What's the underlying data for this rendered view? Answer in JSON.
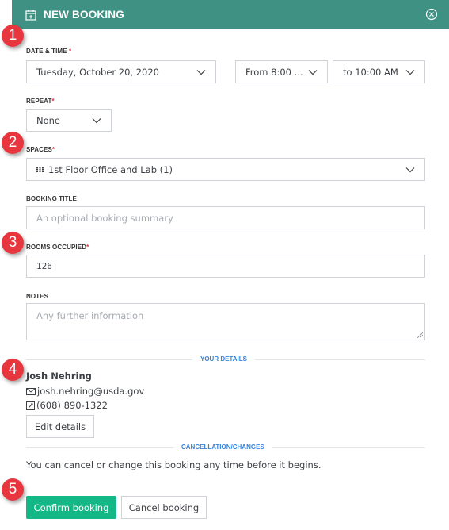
{
  "header": {
    "title": "NEW BOOKING",
    "icon": "calendar-plus-icon",
    "close_icon": "close-circle-icon"
  },
  "date_time": {
    "label": "DATE & TIME",
    "required": "*",
    "date_value": "Tuesday, October 20, 2020",
    "from_value": "From 8:00 ...",
    "to_value": "to 10:00 AM"
  },
  "repeat": {
    "label": "REPEAT",
    "required": "*",
    "value": "None"
  },
  "spaces": {
    "label": "SPACES",
    "required": "*",
    "value": "1st Floor Office and Lab (1)",
    "icon": "grid-icon"
  },
  "booking_title": {
    "label": "BOOKING TITLE",
    "placeholder": "An optional booking summary",
    "value": ""
  },
  "rooms_occupied": {
    "label": "ROOMS OCCUPIED",
    "required": "*",
    "value": "126"
  },
  "notes": {
    "label": "NOTES",
    "placeholder": "Any further information",
    "value": ""
  },
  "your_details": {
    "section_label": "YOUR DETAILS",
    "name": "Josh Nehring",
    "email": "josh.nehring@usda.gov",
    "phone": "(608) 890-1322",
    "edit_label": "Edit details"
  },
  "cancellation": {
    "section_label": "CANCELLATION/CHANGES",
    "text": "You can cancel or change this booking any time before it begins."
  },
  "actions": {
    "confirm_label": "Confirm booking",
    "cancel_label": "Cancel booking"
  },
  "callouts": [
    "1",
    "2",
    "3",
    "4",
    "5"
  ],
  "colors": {
    "header": "#3f9283",
    "primary": "#13b886",
    "accent_link": "#3b82d6",
    "required": "#d9363e",
    "callout": "#e8363f"
  }
}
